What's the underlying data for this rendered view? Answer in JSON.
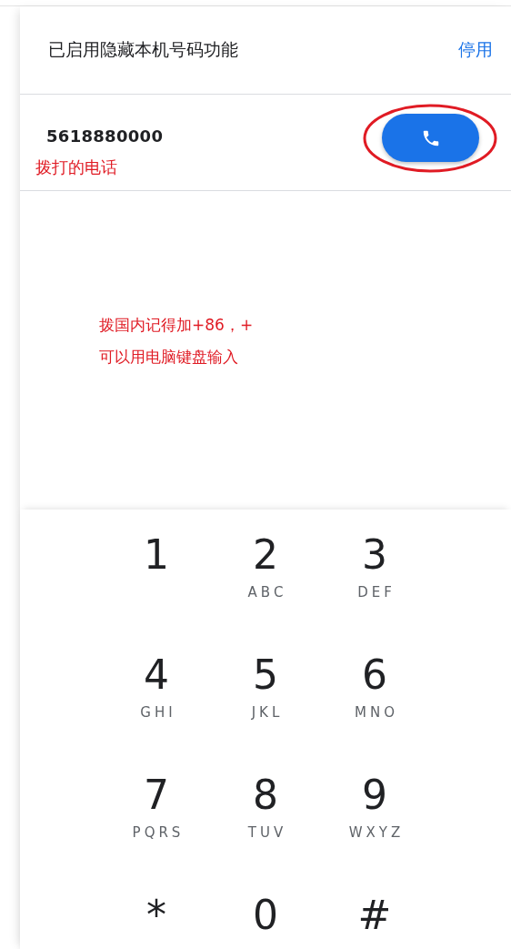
{
  "banner": {
    "message": "已启用隐藏本机号码功能",
    "action": "停用"
  },
  "dial": {
    "number": "5618880000",
    "note": "拨打的电话"
  },
  "hint": [
    "拨国内记得加+86，+",
    "可以用电脑键盘输入"
  ],
  "keypad": [
    {
      "digit": "1"
    },
    {
      "digit": "2",
      "letters": "ABC"
    },
    {
      "digit": "3",
      "letters": "DEF"
    },
    {
      "digit": "4",
      "letters": "GHI"
    },
    {
      "digit": "5",
      "letters": "JKL"
    },
    {
      "digit": "6",
      "letters": "MNO"
    },
    {
      "digit": "7",
      "letters": "PQRS"
    },
    {
      "digit": "8",
      "letters": "TUV"
    },
    {
      "digit": "9",
      "letters": "WXYZ"
    },
    {
      "digit": "*"
    },
    {
      "digit": "0"
    },
    {
      "digit": "#"
    }
  ]
}
